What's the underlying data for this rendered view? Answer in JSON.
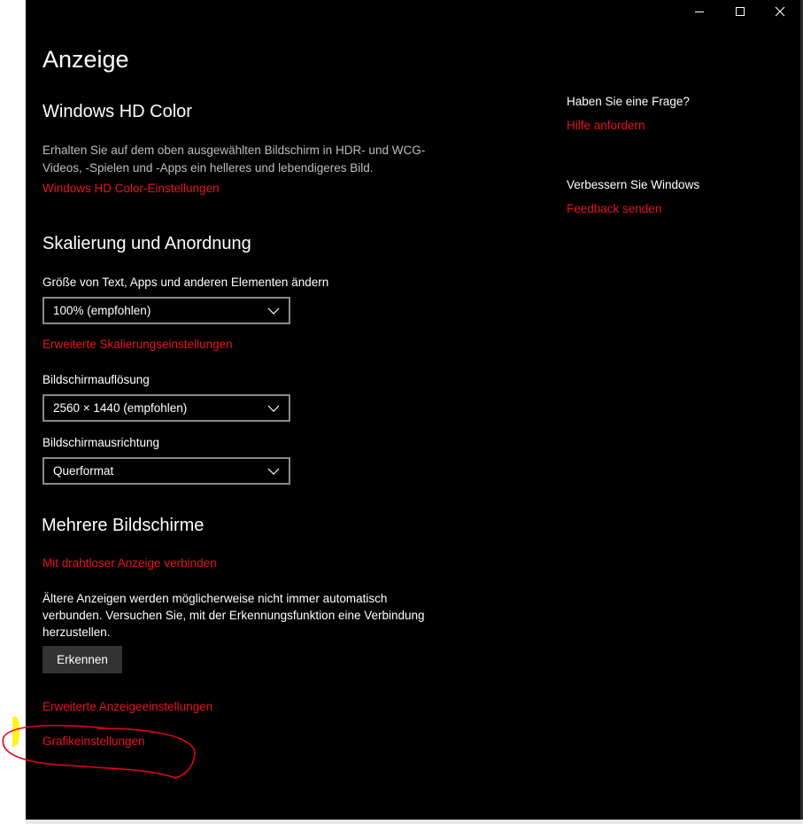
{
  "window": {
    "controls": {
      "minimize_icon": "minimize-icon",
      "maximize_icon": "maximize-icon",
      "close_icon": "close-icon"
    }
  },
  "page": {
    "title": "Anzeige"
  },
  "hd_color": {
    "title": "Windows HD Color",
    "description": "Erhalten Sie auf dem oben ausgewählten Bildschirm in HDR- und WCG-Videos, -Spielen und -Apps ein helleres und lebendigeres Bild.",
    "settings_link": "Windows HD Color-Einstellungen"
  },
  "scale": {
    "title": "Skalierung und Anordnung",
    "size_label": "Größe von Text, Apps und anderen Elementen ändern",
    "size_value": "100% (empfohlen)",
    "advanced_link": "Erweiterte Skalierungseinstellungen",
    "resolution_label": "Bildschirmauflösung",
    "resolution_value": "2560 × 1440 (empfohlen)",
    "orientation_label": "Bildschirmausrichtung",
    "orientation_value": "Querformat"
  },
  "multi": {
    "title": "Mehrere Bildschirme",
    "wireless_link": "Mit drahtloser Anzeige verbinden",
    "older_text": "Ältere Anzeigen werden möglicherweise nicht immer automatisch verbunden. Versuchen Sie, mit der Erkennungsfunktion eine Verbindung herzustellen.",
    "detect_button": "Erkennen",
    "advanced_display_link": "Erweiterte Anzeigeeinstellungen",
    "graphics_link": "Grafikeinstellungen"
  },
  "sidebar": {
    "question_heading": "Haben Sie eine Frage?",
    "help_link": "Hilfe anfordern",
    "improve_heading": "Verbessern Sie Windows",
    "feedback_link": "Feedback senden"
  },
  "colors": {
    "accent": "#e81123",
    "background": "#000000",
    "annotation_circle": "#e3001b",
    "annotation_highlight": "#fff200"
  }
}
